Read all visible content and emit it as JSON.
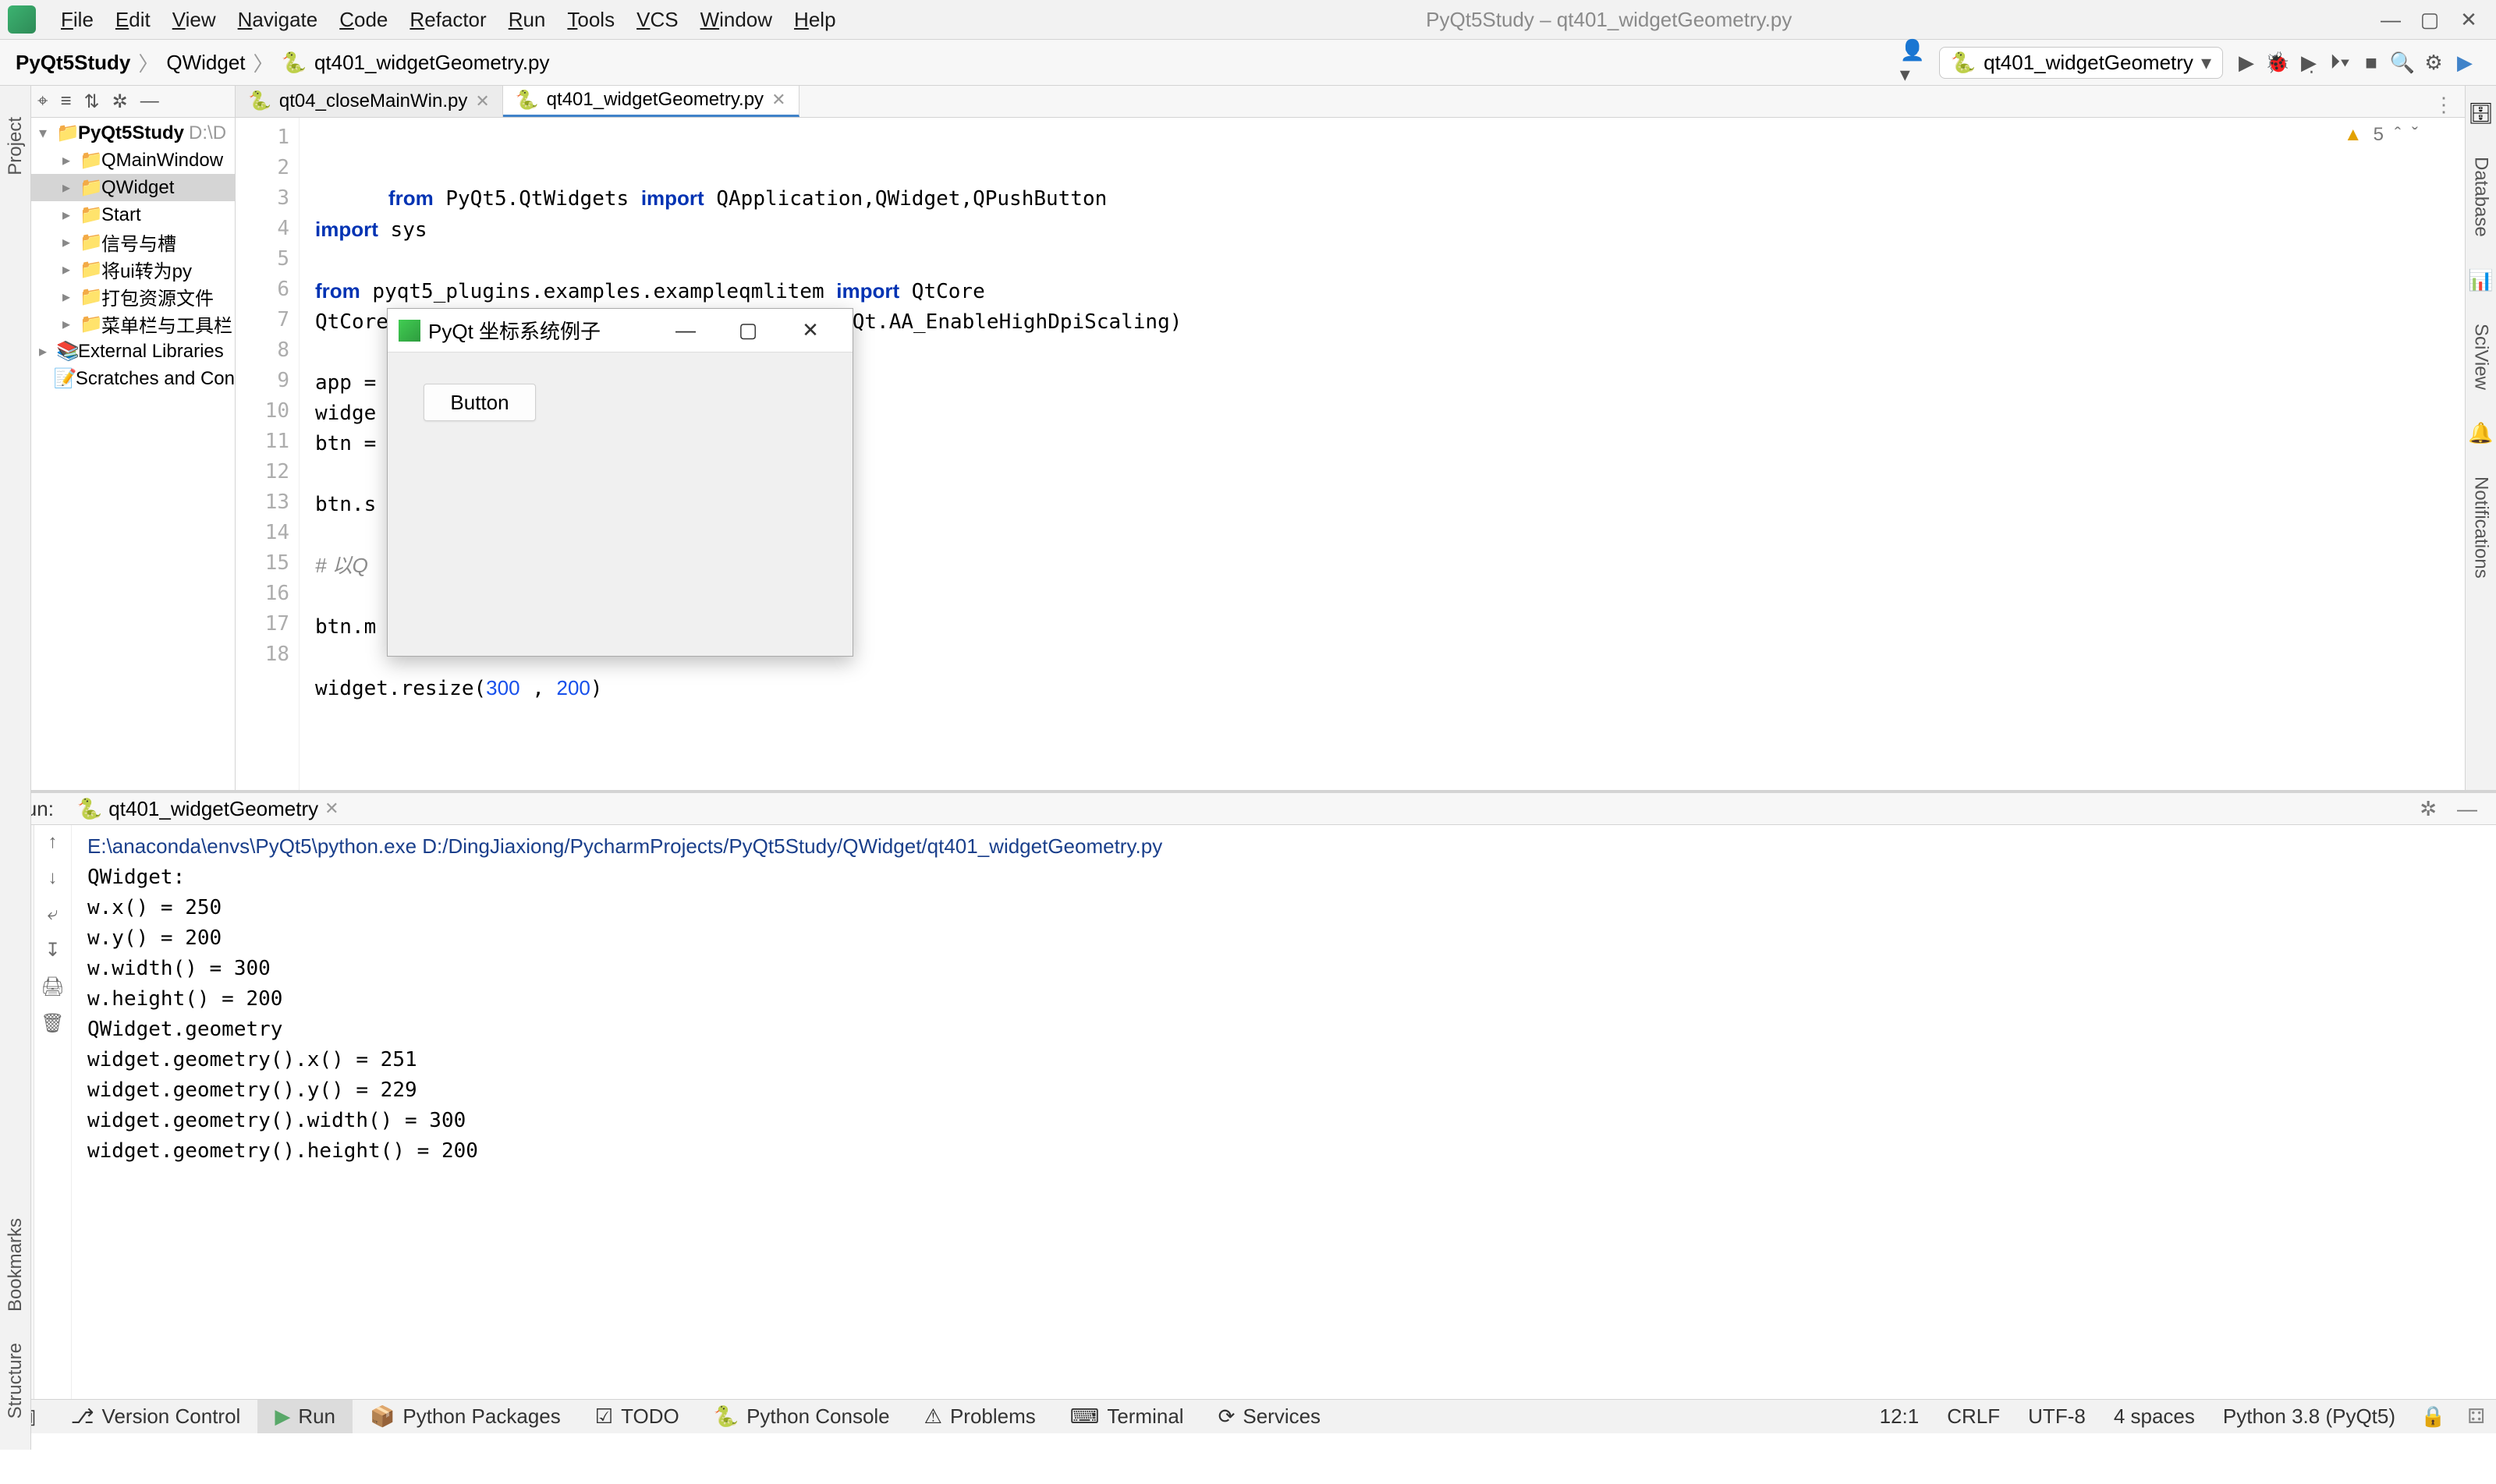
{
  "menubar": {
    "items": [
      "File",
      "Edit",
      "View",
      "Navigate",
      "Code",
      "Refactor",
      "Run",
      "Tools",
      "VCS",
      "Window",
      "Help"
    ],
    "title": "PyQt5Study – qt401_widgetGeometry.py"
  },
  "breadcrumbs": {
    "root": "PyQt5Study",
    "mid": "QWidget",
    "file": "qt401_widgetGeometry.py"
  },
  "run_config": {
    "label": "qt401_widgetGeometry"
  },
  "project": {
    "root": "PyQt5Study",
    "root_path": "D:\\D",
    "nodes": [
      {
        "label": "QMainWindow",
        "kind": "folder"
      },
      {
        "label": "QWidget",
        "kind": "folder",
        "selected": true
      },
      {
        "label": "Start",
        "kind": "folder"
      },
      {
        "label": "信号与槽",
        "kind": "folder"
      },
      {
        "label": "将ui转为py",
        "kind": "folder"
      },
      {
        "label": "打包资源文件",
        "kind": "folder"
      },
      {
        "label": "菜单栏与工具栏",
        "kind": "folder"
      }
    ],
    "ext_libs": "External Libraries",
    "scratches": "Scratches and Con"
  },
  "tabs": {
    "items": [
      {
        "label": "qt04_closeMainWin.py",
        "active": false
      },
      {
        "label": "qt401_widgetGeometry.py",
        "active": true
      }
    ]
  },
  "inspection": {
    "warnings": "5"
  },
  "code": {
    "lines": [
      {
        "n": "1",
        "html": "<span class=\"kw\">from</span> PyQt5.QtWidgets <span class=\"kw\">import</span> QApplication,QWidget,QPushButton"
      },
      {
        "n": "2",
        "html": "<span class=\"kw\">import</span> sys"
      },
      {
        "n": "3",
        "html": ""
      },
      {
        "n": "4",
        "html": "<span class=\"kw\">from</span> pyqt5_plugins.examples.exampleqmlitem <span class=\"kw\">import</span> QtCore"
      },
      {
        "n": "5",
        "html": "QtCore.QCoreApplication.setAttribute(QtCore.Qt.AA_EnableHighDpiScaling)"
      },
      {
        "n": "6",
        "html": ""
      },
      {
        "n": "7",
        "html": "app ="
      },
      {
        "n": "8",
        "html": "widge"
      },
      {
        "n": "9",
        "html": "btn ="
      },
      {
        "n": "10",
        "html": ""
      },
      {
        "n": "11",
        "html": "btn.s"
      },
      {
        "n": "12",
        "html": ""
      },
      {
        "n": "13",
        "html": "<span class=\"cm\"># 以Q</span>"
      },
      {
        "n": "14",
        "html": ""
      },
      {
        "n": "15",
        "html": "btn.m"
      },
      {
        "n": "16",
        "html": ""
      },
      {
        "n": "17",
        "html": "widget.resize(<span class=\"num\">300</span> , <span class=\"num\">200</span>)"
      },
      {
        "n": "18",
        "html": ""
      }
    ]
  },
  "run": {
    "label": "Run:",
    "file": "qt401_widgetGeometry",
    "cmd": "E:\\anaconda\\envs\\PyQt5\\python.exe D:/DingJiaxiong/PycharmProjects/PyQt5Study/QWidget/qt401_widgetGeometry.py",
    "out": [
      "QWidget:",
      "w.x() = 250",
      "w.y() = 200",
      "w.width() = 300",
      "w.height() = 200",
      "QWidget.geometry",
      "widget.geometry().x() = 251",
      "widget.geometry().y() = 229",
      "widget.geometry().width() = 300",
      "widget.geometry().height() = 200"
    ]
  },
  "statusbar": {
    "items": [
      "Version Control",
      "Run",
      "Python Packages",
      "TODO",
      "Python Console",
      "Problems",
      "Terminal",
      "Services"
    ],
    "right": [
      "12:1",
      "CRLF",
      "UTF-8",
      "4 spaces",
      "Python 3.8 (PyQt5)"
    ]
  },
  "sidebars": {
    "project": "Project",
    "bookmarks": "Bookmarks",
    "structure": "Structure",
    "database": "Database",
    "sciview": "SciView",
    "notifications": "Notifications"
  },
  "qt_window": {
    "title": "PyQt 坐标系统例子",
    "button": "Button"
  }
}
